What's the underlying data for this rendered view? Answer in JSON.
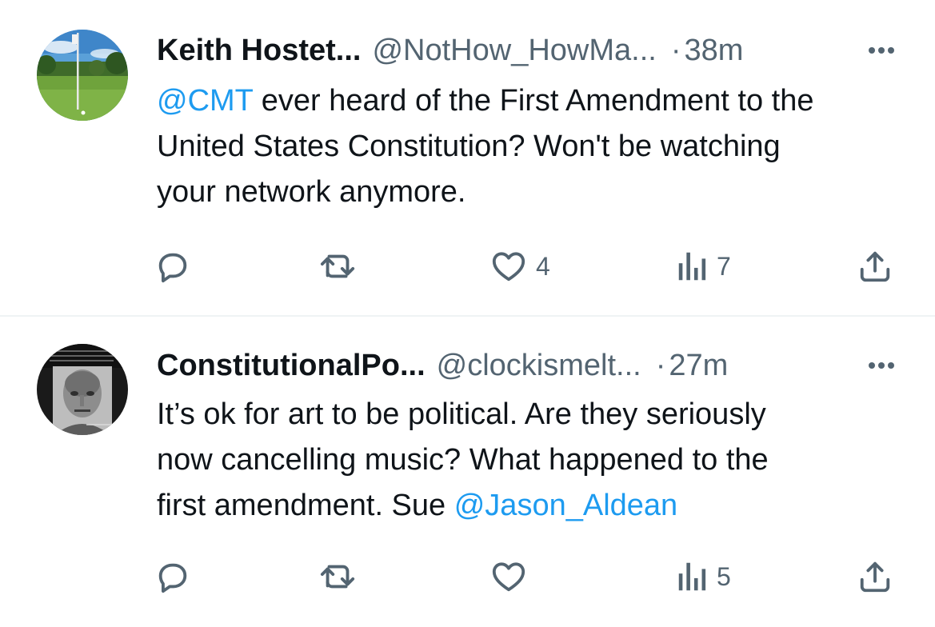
{
  "tweets": [
    {
      "display_name": "Keith Hostet...",
      "handle": "@NotHow_HowMa...",
      "separator": "·",
      "time": "38m",
      "text_lines": [
        {
          "mention": "@CMT",
          "text": " ever heard of the First Amendment to the"
        },
        {
          "text": "United States Constitution? Won't be watching"
        },
        {
          "text": "your network anymore."
        }
      ],
      "actions": {
        "reply": "",
        "retweet": "",
        "like": "4",
        "views": "7",
        "share": ""
      },
      "avatar": "golf-course-flag-avatar"
    },
    {
      "display_name": "ConstitutionalPo...",
      "handle": "@clockismelt...",
      "separator": "·",
      "time": "27m",
      "text_lines": [
        {
          "text": "It’s ok for art to be political. Are they seriously"
        },
        {
          "text": "now cancelling music? What happened to the"
        },
        {
          "text": "first amendment. Sue ",
          "mention": "@Jason_Aldean"
        }
      ],
      "actions": {
        "reply": "",
        "retweet": "",
        "like": "",
        "views": "5",
        "share": ""
      },
      "avatar": "quote-portrait-avatar"
    }
  ],
  "icons": {
    "reply": "reply-icon",
    "retweet": "retweet-icon",
    "like": "heart-icon",
    "views": "views-icon",
    "share": "share-icon",
    "more": "more-icon"
  },
  "colors": {
    "text": "#0f1419",
    "secondary": "#536471",
    "link": "#1d9bf0",
    "divider": "#eff3f4"
  }
}
